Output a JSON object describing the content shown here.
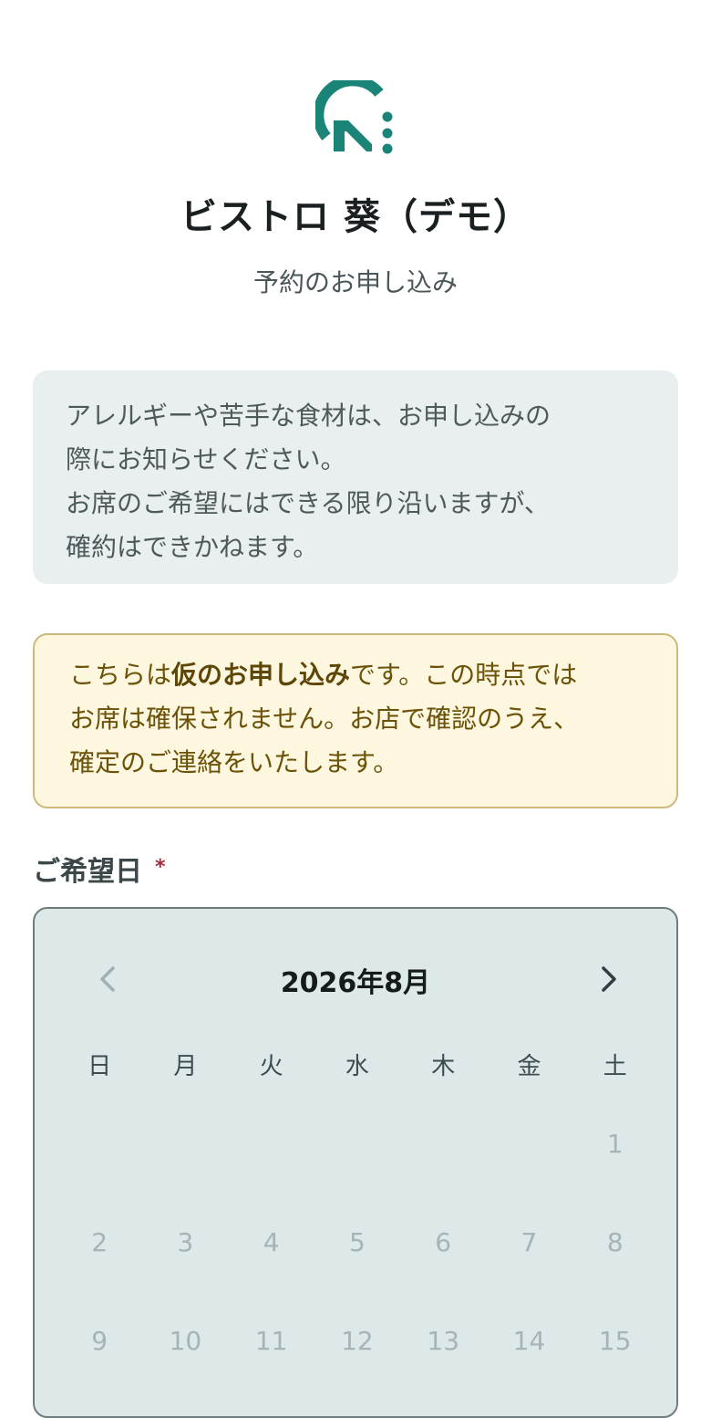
{
  "header": {
    "logo_icon": "restaurant-brand-logo",
    "title": "ビストロ 葵（デモ）",
    "subtitle": "予約のお申し込み"
  },
  "info_notice": {
    "lines": [
      "アレルギーや苦手な食材は、お申し込みの",
      "際にお知らせください。",
      "お席のご希望にはできる限り沿いますが、",
      "確約はできかねます。"
    ]
  },
  "provisional_warning": {
    "line1_prefix": "こちらは",
    "line1_bold": "仮のお申し込み",
    "line1_suffix": "です。この時点では",
    "line2": "お席は確保されません。お店で確認のうえ、",
    "line3": "確定のご連絡をいたします。"
  },
  "date_field": {
    "label": "ご希望日",
    "required_mark": "*"
  },
  "calendar": {
    "month_label": "2026年8月",
    "prev_icon": "chevron-left-icon",
    "next_icon": "chevron-right-icon",
    "weekdays": [
      "日",
      "月",
      "火",
      "水",
      "木",
      "金",
      "土"
    ],
    "days": [
      "",
      "",
      "",
      "",
      "",
      "",
      "1",
      "2",
      "3",
      "4",
      "5",
      "6",
      "7",
      "8",
      "9",
      "10",
      "11",
      "12",
      "13",
      "14",
      "15"
    ]
  },
  "colors": {
    "brand": "#1a8478",
    "required": "#a52c3e",
    "warning_bg": "#fdf7df",
    "notice_bg": "#e8efee",
    "calendar_bg": "#dde8e8"
  }
}
